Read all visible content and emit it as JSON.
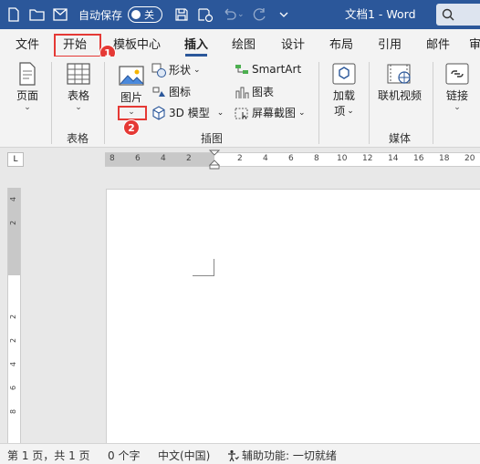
{
  "titlebar": {
    "autosave_label": "自动保存",
    "autosave_state": "关",
    "doc_title": "文档1 - Word",
    "icons": [
      "file-icon",
      "open-folder-icon",
      "send-icon",
      "save-icon",
      "save-refresh-icon",
      "undo-icon",
      "redo-icon",
      "customize-chevron-icon",
      "search-icon"
    ]
  },
  "tabs": [
    {
      "label": "文件"
    },
    {
      "label": "开始"
    },
    {
      "label": "模板中心"
    },
    {
      "label": "插入",
      "active": true
    },
    {
      "label": "绘图"
    },
    {
      "label": "设计"
    },
    {
      "label": "布局"
    },
    {
      "label": "引用"
    },
    {
      "label": "邮件"
    },
    {
      "label": "审"
    }
  ],
  "annotations": {
    "badge1": "1",
    "badge2": "2",
    "highlight_color": "#e53935"
  },
  "ribbon": {
    "pages": {
      "label": "页面",
      "chevron": "⌄"
    },
    "table": {
      "label": "表格",
      "chevron": "⌄",
      "group": "表格"
    },
    "pictures": {
      "label": "图片",
      "chevron": "⌄"
    },
    "shapes": {
      "label": "形状",
      "chevron": "⌄"
    },
    "icons": {
      "label": "图标"
    },
    "model3d": {
      "label": "3D 模型",
      "chevron": "⌄"
    },
    "smartart": {
      "label": "SmartArt"
    },
    "chart": {
      "label": "图表"
    },
    "screenshot": {
      "label": "屏幕截图",
      "chevron": "⌄"
    },
    "illustrations_group": "插图",
    "addins": {
      "label": "加载",
      "label2": "项",
      "chevron": "⌄"
    },
    "online_video": {
      "label": "联机视频"
    },
    "media_group": "媒体",
    "link": {
      "label": "链接",
      "chevron": "⌄"
    }
  },
  "ruler": {
    "tab_selector": "L",
    "h_numbers": [
      "8",
      "6",
      "4",
      "2",
      "2",
      "4",
      "6",
      "8",
      "10",
      "12",
      "14",
      "16",
      "18",
      "20"
    ],
    "v_numbers": [
      "4",
      "2",
      "2",
      "2",
      "4",
      "6",
      "8"
    ]
  },
  "status": {
    "page": "第 1 页，共 1 页",
    "words": "0 个字",
    "language": "中文(中国)",
    "accessibility": "辅助功能: 一切就绪"
  },
  "colors": {
    "accent": "#2b579a"
  }
}
